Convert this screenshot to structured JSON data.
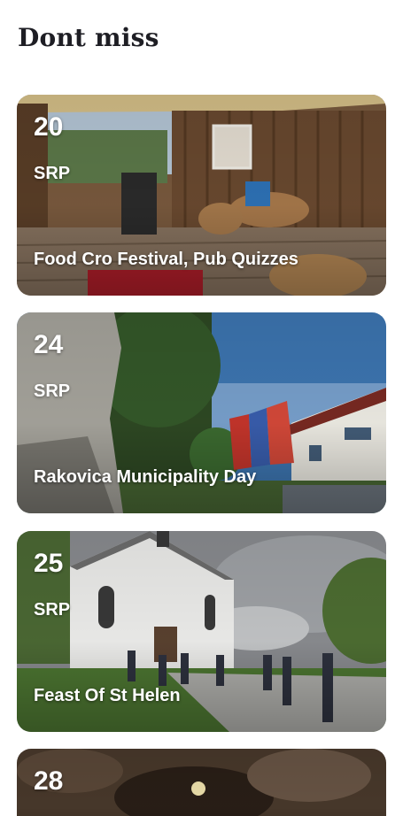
{
  "section": {
    "title": "Dont miss"
  },
  "events": [
    {
      "day": "20",
      "month": "SRP",
      "name": "Food Cro Festival, Pub Quizzes",
      "image": "festival-terrace-photo"
    },
    {
      "day": "24",
      "month": "SRP",
      "name": "Rakovica Municipality Day",
      "image": "statue-flags-photo"
    },
    {
      "day": "25",
      "month": "SRP",
      "name": "Feast Of St Helen",
      "image": "church-crowd-photo"
    },
    {
      "day": "28",
      "month": "",
      "name": "",
      "image": "cave-photo"
    }
  ],
  "colors": {
    "title": "#1e1e24",
    "card_text": "#ffffff"
  }
}
